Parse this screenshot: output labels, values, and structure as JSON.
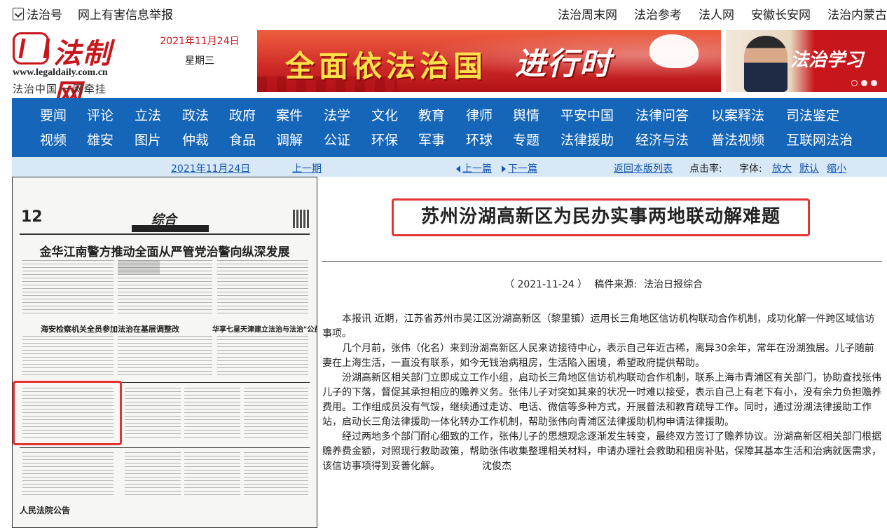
{
  "topbar": {
    "left_items": [
      "法治号",
      "网上有害信息举报"
    ],
    "right_items": [
      "法治周末网",
      "法治参考",
      "法人网",
      "安徽长安网",
      "法治内蒙古"
    ]
  },
  "logo": {
    "name": "法制网",
    "url": "www.legaldaily.com.cn",
    "slogan": "法治中国  一网牵挂"
  },
  "header_date": {
    "date": "2021年11月24日",
    "weekday": "星期三"
  },
  "banner": {
    "text_main": "全面依法治国",
    "text_accent": "进行时"
  },
  "ad": {
    "text": "法治学习"
  },
  "nav": {
    "row1": [
      "要闻",
      "评论",
      "立法",
      "政法",
      "政府",
      "案件",
      "法学",
      "文化",
      "教育",
      "律师",
      "舆情",
      "平安中国",
      "法律问答",
      "以案释法",
      "司法鉴定"
    ],
    "row2": [
      "视频",
      "雄安",
      "图片",
      "仲裁",
      "食品",
      "调解",
      "公证",
      "环保",
      "军事",
      "环球",
      "专题",
      "法律援助",
      "经济与法",
      "普法视频",
      "互联网法治"
    ]
  },
  "subbar": {
    "date": "2021年11月24日",
    "prev_issue": "上一期",
    "prev_article": "上一篇",
    "next_article": "下一篇",
    "back": "返回本版列表",
    "hits_label": "点击率:",
    "font_label": "字体:",
    "font_big": "放大",
    "font_default": "默认",
    "font_small": "缩小"
  },
  "thumbnail": {
    "page_num": "12",
    "section": "综合",
    "headline": "金华江南警方推动全面从严管党治警向纵深发展",
    "sub1": "海安检察机关全员参加法治在基层调整改",
    "sub2": "华享七星天津建立法治与法治\"公益扶贫\"机制",
    "foot": "人民法院公告"
  },
  "article": {
    "title": "苏州汾湖高新区为民办实事两地联动解难题",
    "date": "（ 2021-11-24 ）",
    "source_label": "稿件来源:",
    "source": "法治日报综合",
    "paragraphs": [
      "本报讯 近期，江苏省苏州市吴江区汾湖高新区（黎里镇）运用长三角地区信访机构联动合作机制，成功化解一件跨区域信访事项。",
      "几个月前，张伟（化名）来到汾湖高新区人民来访接待中心，表示自己年近古稀，离异30余年，常年在汾湖独居。儿子随前妻在上海生活，一直没有联系，如今无钱治病租房，生活陷入困境，希望政府提供帮助。",
      "汾湖高新区相关部门立即成立工作小组，启动长三角地区信访机构联动合作机制，联系上海市青浦区有关部门，协助查找张伟儿子的下落，督促其承担相应的赡养义务。张伟儿子对突如其来的状况一时难以接受，表示自己上有老下有小，没有余力负担赡养费用。工作组成员没有气馁，继续通过走访、电话、微信等多种方式，开展普法和教育疏导工作。同时，通过汾湖法律援助工作站，启动长三角法律援助一体化转办工作机制，帮助张伟向青浦区法律援助机构申请法律援助。",
      "经过两地多个部门耐心细致的工作，张伟儿子的思想观念逐渐发生转变，最终双方签订了赡养协议。汾湖高新区相关部门根据赡养费金额，对照现行救助政策，帮助张伟收集整理相关材料，申请办理社会救助和租房补贴，保障其基本生活和治病就医需求，该信访事项得到妥善化解。"
    ],
    "author": "沈俊杰"
  },
  "colors": {
    "brand_red": "#c8161d",
    "nav_blue": "#1565b8",
    "subbar_bg": "#d8e8f7",
    "highlight_red": "#e53232"
  }
}
